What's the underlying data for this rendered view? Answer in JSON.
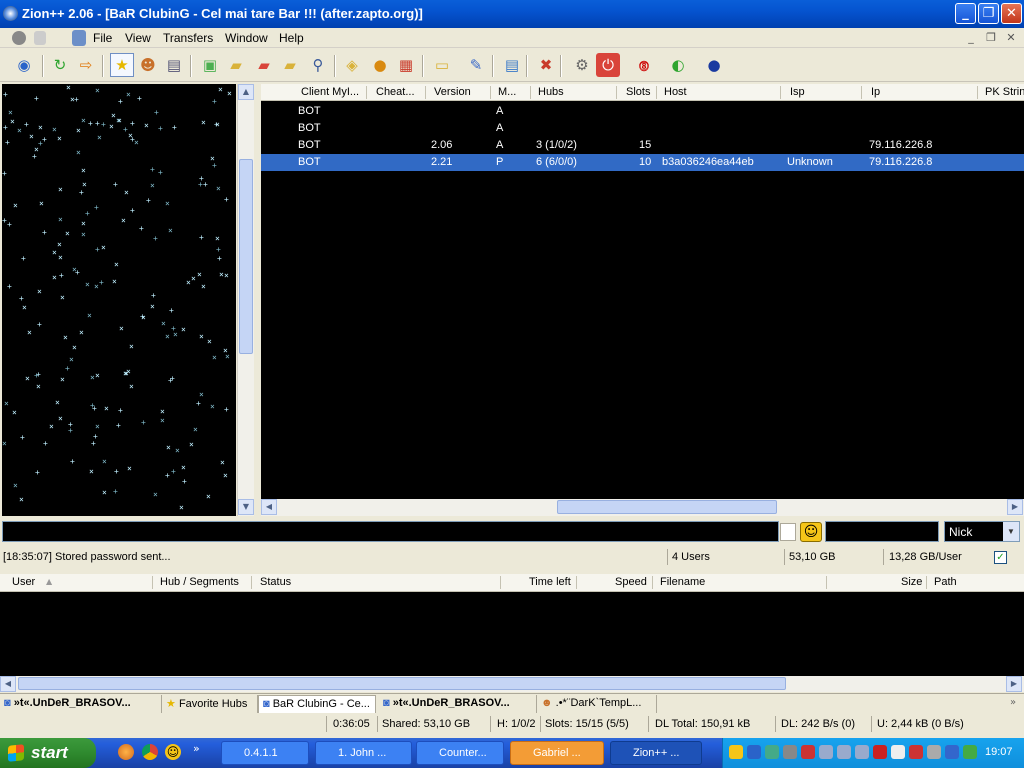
{
  "window": {
    "title": "Zion++ 2.06 - [BaR ClubinG - Cel mai tare Bar !!! (after.zapto.org)]"
  },
  "menu": [
    "File",
    "View",
    "Transfers",
    "Window",
    "Help"
  ],
  "userlist": {
    "columns": [
      "Client MyI...",
      "Cheat...",
      "Version",
      "M...",
      "Hubs",
      "Slots",
      "Host",
      "Isp",
      "Ip",
      "PK Strin"
    ],
    "rows": [
      {
        "client": "BOT",
        "version": "",
        "mode": "A",
        "hubs": "",
        "slots": "",
        "host": "",
        "isp": "",
        "ip": ""
      },
      {
        "client": "BOT",
        "version": "",
        "mode": "A",
        "hubs": "",
        "slots": "",
        "host": "",
        "isp": "",
        "ip": ""
      },
      {
        "client": "BOT",
        "version": "2.06",
        "mode": "A",
        "hubs": "3 (1/0/2)",
        "slots": "15",
        "host": "",
        "isp": "",
        "ip": "79.116.226.8"
      },
      {
        "client": "BOT",
        "version": "2.21",
        "mode": "P",
        "hubs": "6 (6/0/0)",
        "slots": "10",
        "host": "b3a036246ea44eb",
        "isp": "Unknown",
        "ip": "79.116.226.8",
        "selected": true
      }
    ]
  },
  "chat": {
    "filter_select": "Nick"
  },
  "hub_status": {
    "message": "[18:35:07] Stored password sent...",
    "users": "4 Users",
    "shared": "53,10 GB",
    "per_user": "13,28 GB/User"
  },
  "queue": {
    "columns": [
      "User",
      "Hub / Segments",
      "Status",
      "Time left",
      "Speed",
      "Filename",
      "Size",
      "Path"
    ]
  },
  "tabs": [
    "»t«.UnDeR_BRASOV...",
    "Favorite Hubs",
    "BaR ClubinG - Ce...",
    "»t«.UnDeR_BRASOV...",
    ".•*¨DarK`TempL..."
  ],
  "status": {
    "time": "0:36:05",
    "shared": "Shared: 53,10 GB",
    "hubs": "H: 1/0/2",
    "slots": "Slots: 15/15 (5/5)",
    "dl_total": "DL Total: 150,91 kB",
    "dl": "DL: 242 B/s (0)",
    "ul": "U: 2,44 kB (0 B/s)"
  },
  "taskbar": {
    "start_label": "start",
    "tasks": [
      "0.4.1.1",
      "1. John ...",
      "Counter...",
      "Gabriel ...",
      "Zion++ ..."
    ],
    "clock": "19:07"
  }
}
